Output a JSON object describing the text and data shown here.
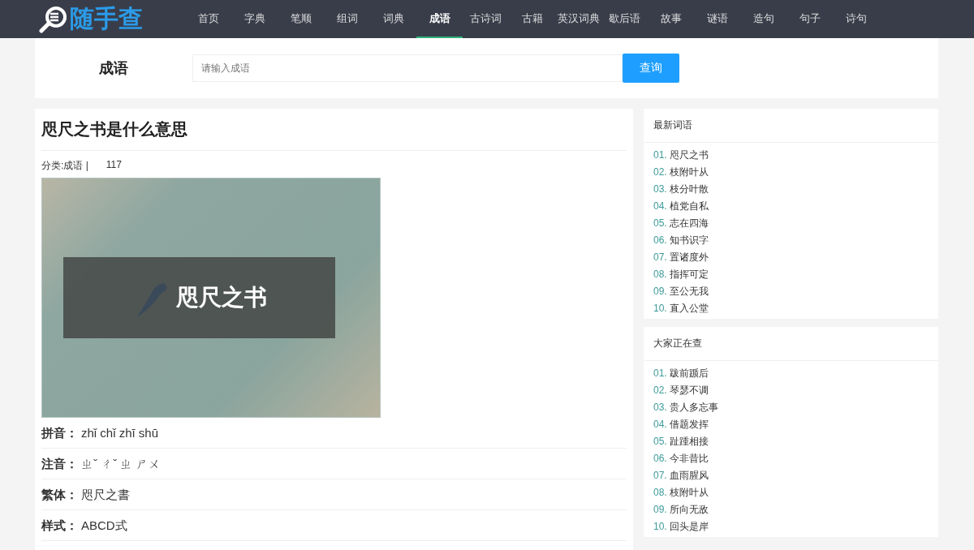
{
  "logo": {
    "text": "随手查"
  },
  "nav": [
    {
      "label": "首页",
      "selected": false
    },
    {
      "label": "字典",
      "selected": false
    },
    {
      "label": "笔顺",
      "selected": false
    },
    {
      "label": "组词",
      "selected": false
    },
    {
      "label": "词典",
      "selected": false
    },
    {
      "label": "成语",
      "selected": true
    },
    {
      "label": "古诗词",
      "selected": false
    },
    {
      "label": "古籍",
      "selected": false
    },
    {
      "label": "英汉词典",
      "selected": false
    },
    {
      "label": "歇后语",
      "selected": false
    },
    {
      "label": "故事",
      "selected": false
    },
    {
      "label": "谜语",
      "selected": false
    },
    {
      "label": "造句",
      "selected": false
    },
    {
      "label": "句子",
      "selected": false
    },
    {
      "label": "诗句",
      "selected": false
    }
  ],
  "search": {
    "label": "成语",
    "placeholder": "请输入成语",
    "button": "查询"
  },
  "article": {
    "title": "咫尺之书是什么意思",
    "category": "分类:成语 |",
    "views": "117",
    "cover_title": "咫尺之书",
    "fields": [
      {
        "label": "拼音：",
        "value": "zhǐ chǐ zhī shū"
      },
      {
        "label": "注音：",
        "value": "ㄓˇ ㄔˇ ㄓ ㄕㄨ"
      },
      {
        "label": "繁体：",
        "value": "咫尺之書"
      },
      {
        "label": "样式：",
        "value": "ABCD式"
      }
    ]
  },
  "sidebar": [
    {
      "title": "最新词语",
      "items": [
        {
          "num": "01.",
          "text": "咫尺之书"
        },
        {
          "num": "02.",
          "text": "枝附叶从"
        },
        {
          "num": "03.",
          "text": "枝分叶散"
        },
        {
          "num": "04.",
          "text": "植党自私"
        },
        {
          "num": "05.",
          "text": "志在四海"
        },
        {
          "num": "06.",
          "text": "知书识字"
        },
        {
          "num": "07.",
          "text": "置诸度外"
        },
        {
          "num": "08.",
          "text": "指挥可定"
        },
        {
          "num": "09.",
          "text": "至公无我"
        },
        {
          "num": "10.",
          "text": "直入公堂"
        }
      ]
    },
    {
      "title": "大家正在查",
      "items": [
        {
          "num": "01.",
          "text": "跋前踬后"
        },
        {
          "num": "02.",
          "text": "琴瑟不调"
        },
        {
          "num": "03.",
          "text": "贵人多忘事"
        },
        {
          "num": "04.",
          "text": "借题发挥"
        },
        {
          "num": "05.",
          "text": "趾踵相接"
        },
        {
          "num": "06.",
          "text": "今非昔比"
        },
        {
          "num": "07.",
          "text": "血雨腥风"
        },
        {
          "num": "08.",
          "text": "枝附叶从"
        },
        {
          "num": "09.",
          "text": "所向无敌"
        },
        {
          "num": "10.",
          "text": "回头是岸"
        }
      ]
    }
  ]
}
